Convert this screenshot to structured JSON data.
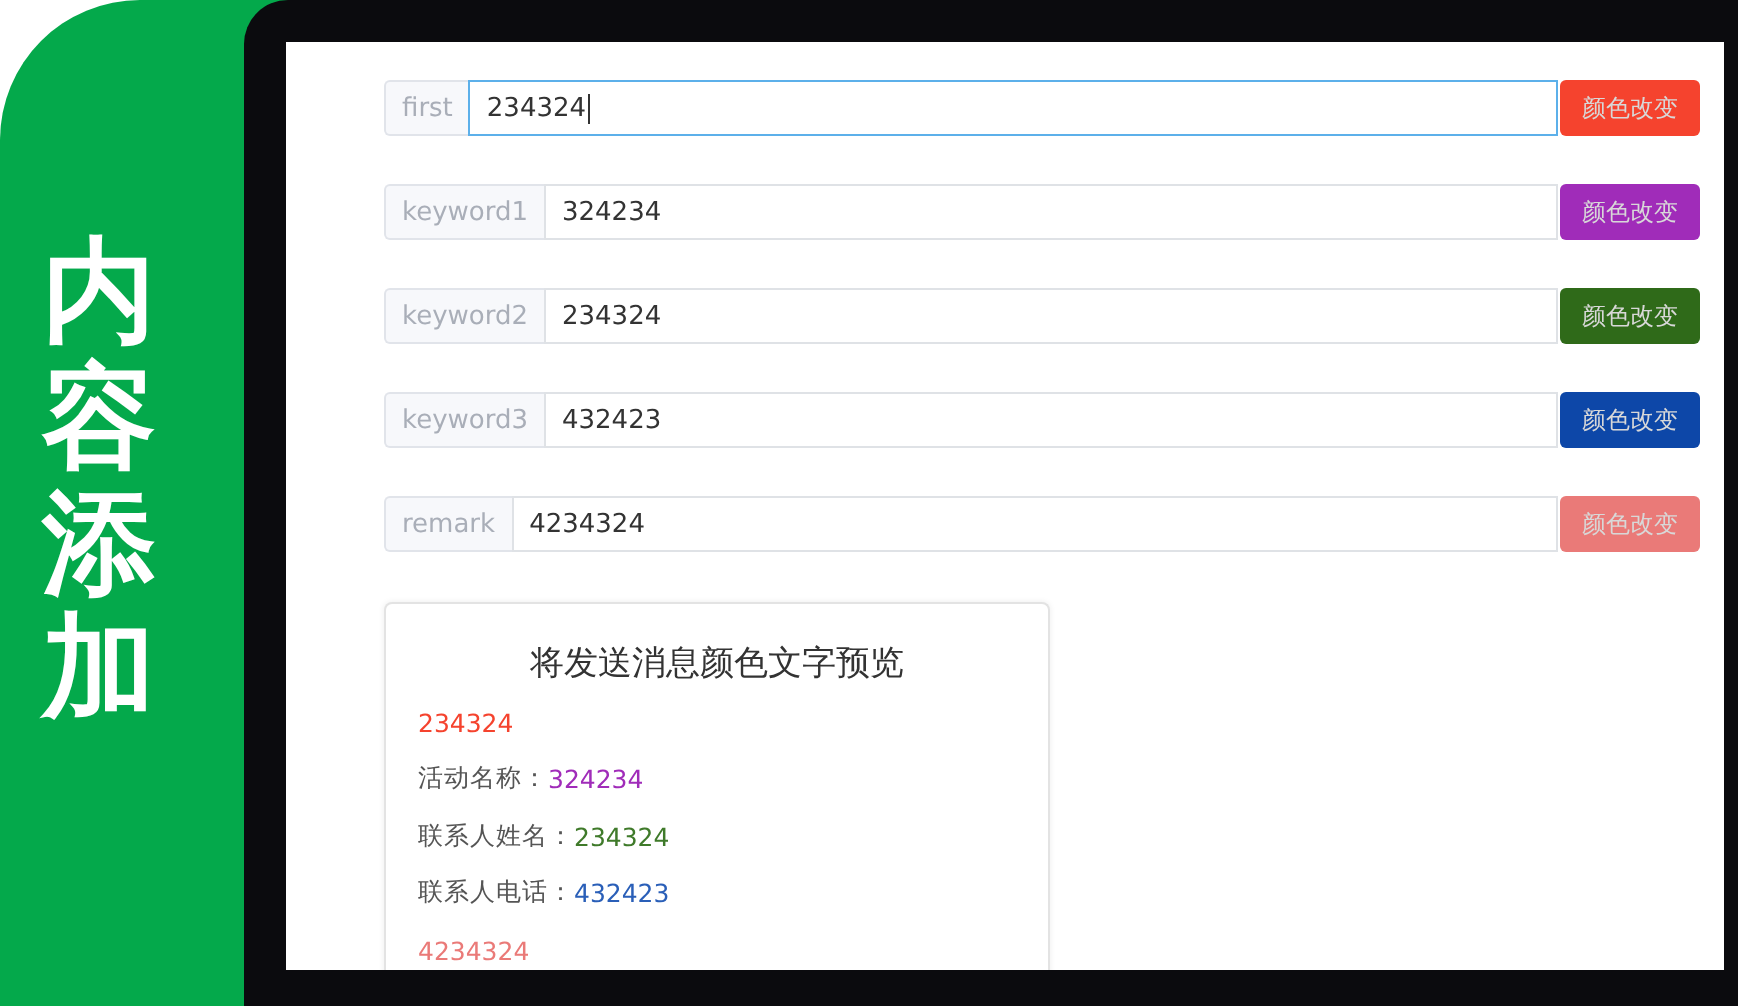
{
  "side_banner": {
    "title": "内容添加"
  },
  "fields": [
    {
      "label": "first",
      "value": "234324",
      "focused": true,
      "button": "颜色改变",
      "color": "#f5432e"
    },
    {
      "label": "keyword1",
      "value": "324234",
      "focused": false,
      "button": "颜色改变",
      "color": "#a02cb9"
    },
    {
      "label": "keyword2",
      "value": "234324",
      "focused": false,
      "button": "颜色改变",
      "color": "#2f6a19"
    },
    {
      "label": "keyword3",
      "value": "432423",
      "focused": false,
      "button": "颜色改变",
      "color": "#0d47a8"
    },
    {
      "label": "remark",
      "value": "4234324",
      "focused": false,
      "button": "颜色改变",
      "color": "#ea7a78"
    }
  ],
  "preview": {
    "title": "将发送消息颜色文字预览",
    "lines": [
      {
        "value": "234324",
        "color": "#f5432e"
      },
      {
        "prefix": "活动名称：",
        "value": "324234",
        "color": "#a02cb9"
      },
      {
        "prefix": "联系人姓名：",
        "value": "234324",
        "color": "#3f7a2a"
      },
      {
        "prefix": "联系人电话：",
        "value": "432423",
        "color": "#2a5fb8"
      },
      {
        "value": "4234324",
        "color": "#ea7a78"
      }
    ]
  }
}
